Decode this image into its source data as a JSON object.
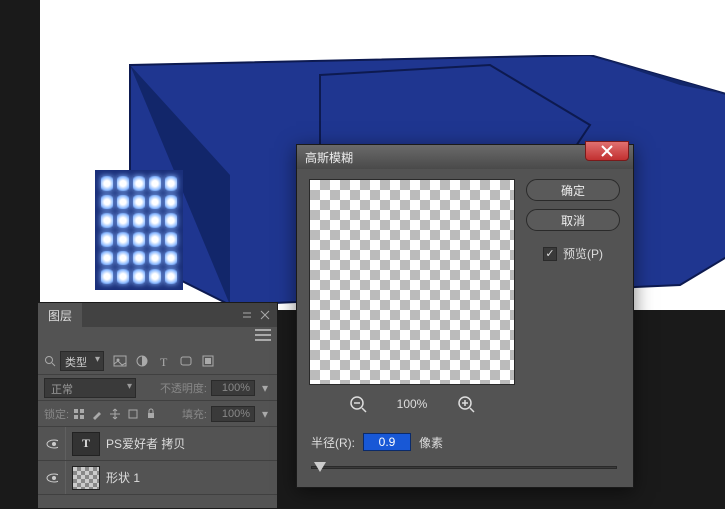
{
  "layers_panel": {
    "tab_label": "图层",
    "filter_label": "类型",
    "blend_mode": "正常",
    "opacity_label": "不透明度:",
    "opacity_value": "100%",
    "lock_label": "锁定:",
    "fill_label": "填充:",
    "fill_value": "100%",
    "layers": [
      {
        "name": "PS爱好者 拷贝",
        "kind": "text",
        "thumb_letter": "T",
        "visible": true
      },
      {
        "name": "形状 1",
        "kind": "shape",
        "visible": true
      }
    ]
  },
  "dialog": {
    "title": "高斯模糊",
    "ok_label": "确定",
    "cancel_label": "取消",
    "preview_label": "预览(P)",
    "preview_checked": true,
    "zoom_percent": "100%",
    "radius_label": "半径(R):",
    "radius_value": "0.9",
    "radius_unit": "像素"
  },
  "icons": {
    "search": "search-icon",
    "image_filter": "image-filter-icon",
    "adjust_filter": "adjust-filter-icon",
    "text_filter": "text-filter-icon",
    "shape_filter": "shape-filter-icon",
    "smart_filter": "smart-filter-icon",
    "lock_pixels": "lock-pixels-icon",
    "lock_paint": "lock-paint-icon",
    "lock_position": "lock-position-icon",
    "lock_artboard": "lock-artboard-icon",
    "lock_all": "lock-all-icon",
    "eye": "eye-icon",
    "zoom_out": "zoom-out-icon",
    "zoom_in": "zoom-in-icon",
    "close": "close-icon",
    "collapse": "collapse-icon",
    "menu": "menu-icon"
  }
}
